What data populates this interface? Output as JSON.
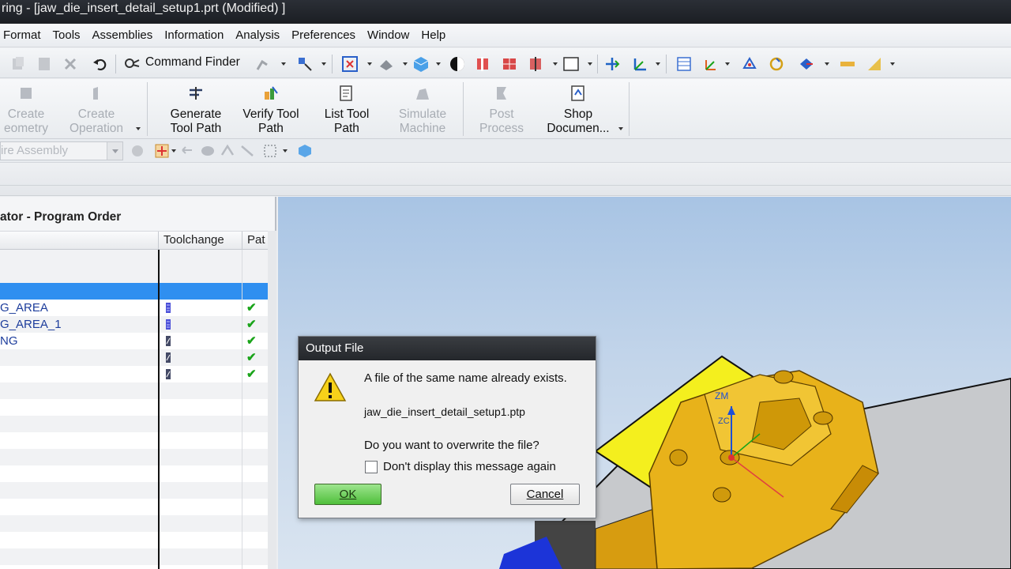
{
  "window": {
    "title": "ring - [jaw_die_insert_detail_setup1.prt (Modified) ]"
  },
  "menu": [
    {
      "label": "Format"
    },
    {
      "label": "Tools"
    },
    {
      "label": "Assemblies"
    },
    {
      "label": "Information"
    },
    {
      "label": "Analysis"
    },
    {
      "label": "Preferences"
    },
    {
      "label": "Window"
    },
    {
      "label": "Help"
    }
  ],
  "toolbar": {
    "command_finder": "Command Finder"
  },
  "ribbon": {
    "create_geometry": "Create\neometry",
    "create_operation": "Create\nOperation",
    "generate_tool_path": "Generate\nTool Path",
    "verify_tool_path": "Verify Tool\nPath",
    "list_tool_path": "List Tool\nPath",
    "simulate_machine": "Simulate\nMachine",
    "post_process": "Post\nProcess",
    "shop_documentation": "Shop\nDocumen..."
  },
  "toolbar2": {
    "assembly_select": "ire Assembly"
  },
  "navigator": {
    "title": "ator - Program Order",
    "columns": [
      "Toolchange",
      "Pat"
    ],
    "rows": [
      {
        "name": "",
        "state": "blank"
      },
      {
        "name": "",
        "state": "selected"
      },
      {
        "name": "G_AREA",
        "state": "ok"
      },
      {
        "name": "G_AREA_1",
        "state": "ok"
      },
      {
        "name": "NG",
        "state": "ok"
      },
      {
        "name": "",
        "state": "ok"
      },
      {
        "name": "",
        "state": "ok"
      }
    ],
    "check_mark": "✔"
  },
  "dialog": {
    "title": "Output File",
    "message": "A file of the same name already exists.",
    "filename": "jaw_die_insert_detail_setup1.ptp",
    "question": "Do you want to overwrite the file?",
    "checkbox_label": "Don't display this message again",
    "checkbox_checked": false,
    "ok_label": "OK",
    "cancel_label": "Cancel"
  },
  "viewport": {
    "triad_zm": "ZM",
    "triad_zc": "ZC"
  },
  "colors": {
    "selection": "#2f8ff0",
    "dialog_title": "#24272b",
    "ok_button": "#4fbf3b",
    "part_yellow": "#f0c419"
  }
}
